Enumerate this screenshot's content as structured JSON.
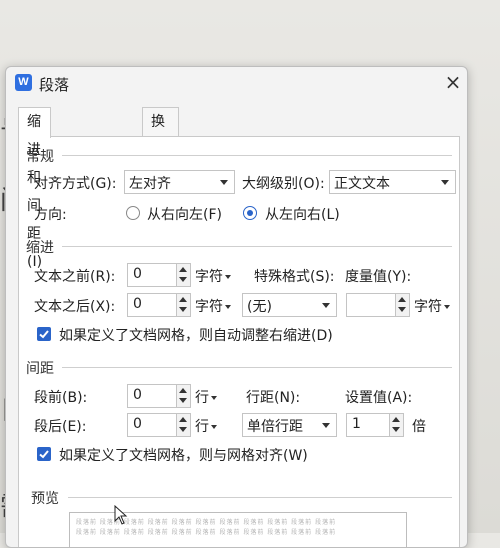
{
  "dialog": {
    "title": "段落",
    "logo_letter": "W",
    "close": "×",
    "tabs": [
      {
        "label": "缩进和间距(I)",
        "active": true
      },
      {
        "label": "换行和分页(P)",
        "active": false
      }
    ]
  },
  "general": {
    "section_label": "常规",
    "align_label": "对齐方式(G):",
    "align_value": "左对齐",
    "outline_label": "大纲级别(O):",
    "outline_value": "正文文本",
    "direction_label": "方向:",
    "direction_rtl": "从右向左(F)",
    "direction_ltr": "从左向右(L)",
    "direction_selected": "ltr"
  },
  "indent": {
    "section_label": "缩进",
    "before_label": "文本之前(R):",
    "before_value": "0",
    "before_unit": "字符",
    "after_label": "文本之后(X):",
    "after_value": "0",
    "after_unit": "字符",
    "special_label": "特殊格式(S):",
    "special_value": "(无)",
    "measure_label": "度量值(Y):",
    "measure_value": "",
    "measure_unit": "字符",
    "grid_check_label": "如果定义了文档网格，则自动调整右缩进(D)",
    "grid_checked": true
  },
  "spacing": {
    "section_label": "间距",
    "before_label": "段前(B):",
    "before_value": "0",
    "before_unit": "行",
    "after_label": "段后(E):",
    "after_value": "0",
    "after_unit": "行",
    "line_label": "行距(N):",
    "line_value": "单倍行距",
    "setting_label": "设置值(A):",
    "setting_value": "1",
    "setting_unit": "倍",
    "grid_check_label": "如果定义了文档网格，则与网格对齐(W)",
    "grid_checked": true
  },
  "preview": {
    "section_label": "预览",
    "sample_text": "段落前 段落前 段落前 段落前 段落前 段落前 段落前 段落前 段落前 段落前 段落前"
  },
  "background_doc": {
    "chars": [
      "号",
      "间",
      "日",
      "需"
    ]
  },
  "colors": {
    "accent": "#2a64c9",
    "logo": "#2f6fe0"
  }
}
